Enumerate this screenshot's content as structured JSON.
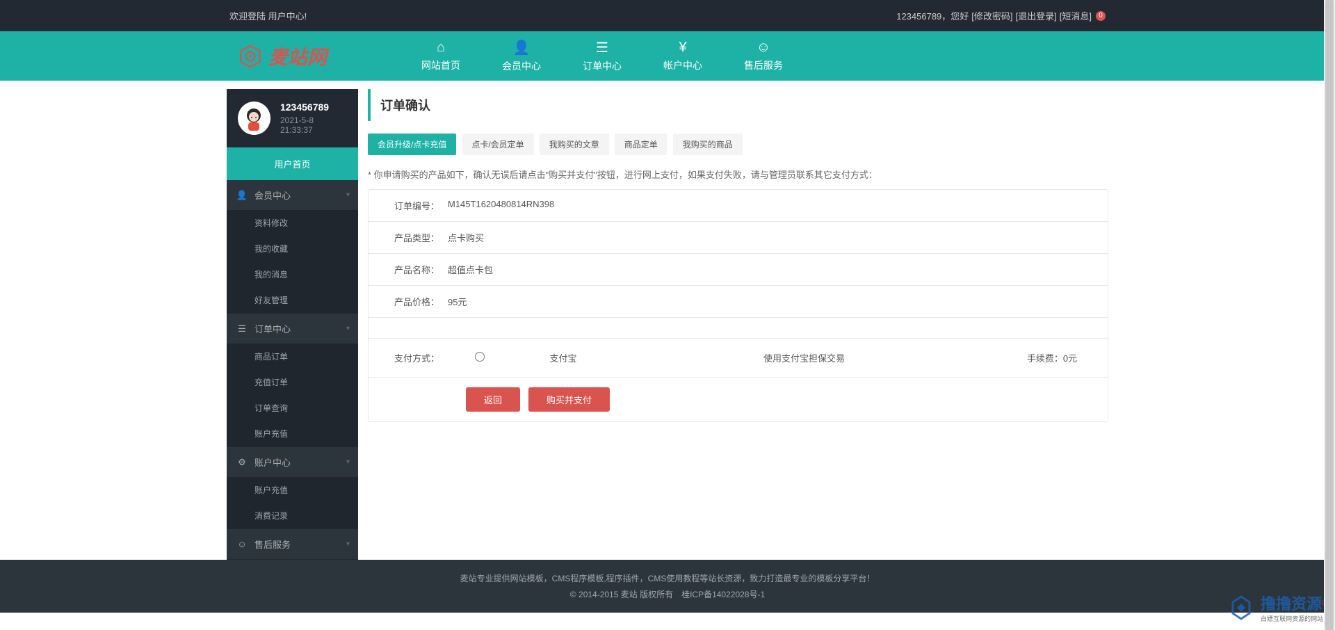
{
  "topbar": {
    "welcome": "欢迎登陆 用户中心!",
    "username": "123456789，您好",
    "change_pw": "[修改密码]",
    "logout": "[退出登录]",
    "msg": "[短消息]",
    "msg_count": "0"
  },
  "logo": {
    "text": "麦站网"
  },
  "nav": [
    {
      "label": "网站首页"
    },
    {
      "label": "会员中心"
    },
    {
      "label": "订单中心"
    },
    {
      "label": "帐户中心"
    },
    {
      "label": "售后服务"
    }
  ],
  "profile": {
    "name": "123456789",
    "time": "2021-5-8 21:33:37"
  },
  "sidebar": {
    "active": "用户首页",
    "groups": [
      {
        "label": "会员中心",
        "items": [
          "资料修改",
          "我的收藏",
          "我的消息",
          "好友管理"
        ]
      },
      {
        "label": "订单中心",
        "items": [
          "商品订单",
          "充值订单",
          "订单查询",
          "账户充值"
        ]
      },
      {
        "label": "账户中心",
        "items": [
          "账户充值",
          "消费记录"
        ]
      },
      {
        "label": "售后服务",
        "items": []
      }
    ]
  },
  "main": {
    "title": "订单确认",
    "tabs": [
      "会员升级/点卡充值",
      "点卡/会员定单",
      "我购买的文章",
      "商品定单",
      "我购买的商品"
    ],
    "notice": "* 你申请购买的产品如下，确认无误后请点击\"购买并支付\"按钮，进行网上支付，如果支付失败，请与管理员联系其它支付方式：",
    "order": {
      "number_label": "订单编号：",
      "number": "M145T1620480814RN398",
      "type_label": "产品类型：",
      "type": "点卡购买",
      "name_label": "产品名称：",
      "name": "超值点卡包",
      "price_label": "产品价格：",
      "price": "95元",
      "paymethod_label": "支付方式：",
      "pay_name": "支付宝",
      "pay_desc": "使用支付宝担保交易",
      "pay_fee_label": "手续费：",
      "pay_fee": "0元"
    },
    "btn_return": "返回",
    "btn_buy": "购买并支付"
  },
  "footer": {
    "line1": "麦站专业提供网站模板，CMS程序模板,程序插件，CMS使用教程等站长资源，致力打造最专业的模板分享平台！",
    "line2": "© 2014-2015 麦站 版权所有　桂ICP备14022028号-1"
  },
  "watermark": {
    "text": "撸撸资源",
    "sub": "白嫖互联网资源的网站"
  }
}
